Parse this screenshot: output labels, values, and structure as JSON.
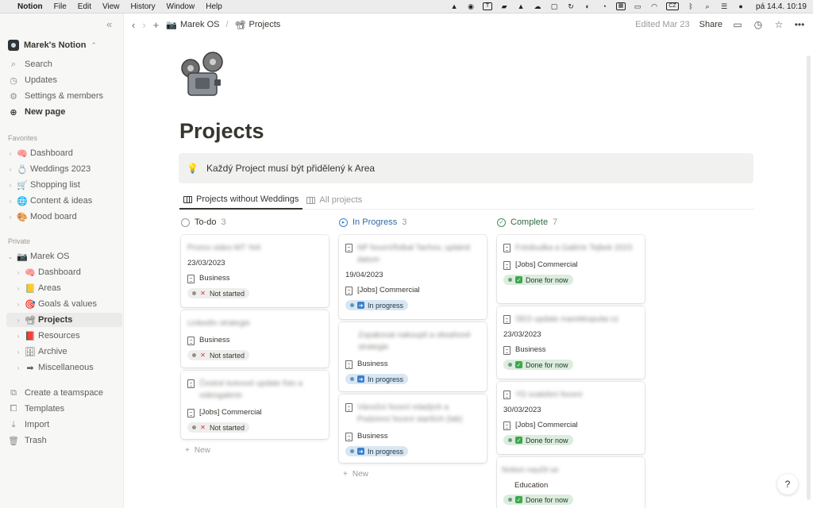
{
  "menubar": {
    "app": "Notion",
    "menus": [
      "File",
      "Edit",
      "View",
      "History",
      "Window",
      "Help"
    ],
    "keyboard": "CZ",
    "clock": "pá 14.4.  10:19"
  },
  "sidebar": {
    "workspace": "Marek's Notion",
    "top_items": [
      {
        "label": "Search",
        "icon": "search-icon"
      },
      {
        "label": "Updates",
        "icon": "clock-icon"
      },
      {
        "label": "Settings & members",
        "icon": "gear-icon"
      },
      {
        "label": "New page",
        "icon": "plus-circle-icon"
      }
    ],
    "favorites_label": "Favorites",
    "favorites": [
      {
        "label": "Dashboard",
        "emoji": "🧠"
      },
      {
        "label": "Weddings 2023",
        "emoji": "💍"
      },
      {
        "label": "Shopping list",
        "emoji": "🛒"
      },
      {
        "label": "Content & ideas",
        "emoji": "🌐"
      },
      {
        "label": "Mood board",
        "emoji": "🎨"
      }
    ],
    "private_label": "Private",
    "private_root": {
      "label": "Marek OS",
      "emoji": "📷"
    },
    "private_children": [
      {
        "label": "Dashboard",
        "emoji": "🧠"
      },
      {
        "label": "Areas",
        "emoji": "📒"
      },
      {
        "label": "Goals & values",
        "emoji": "🎯"
      },
      {
        "label": "Projects",
        "emoji": "📽"
      },
      {
        "label": "Resources",
        "emoji": "📕"
      },
      {
        "label": "Archive",
        "emoji": "🗄"
      },
      {
        "label": "Miscellaneous",
        "emoji": "➡"
      }
    ],
    "bottom_items": [
      {
        "label": "Create a teamspace",
        "icon": "teamspace-icon"
      },
      {
        "label": "Templates",
        "icon": "templates-icon"
      },
      {
        "label": "Import",
        "icon": "import-icon"
      },
      {
        "label": "Trash",
        "icon": "trash-icon"
      }
    ]
  },
  "topbar": {
    "breadcrumb_parent": "Marek OS",
    "breadcrumb_current": "Projects",
    "edited": "Edited Mar 23",
    "share": "Share"
  },
  "page": {
    "title": "Projects",
    "callout": "Každý Project musí být přidělený k Area",
    "tabs": [
      "Projects without Weddings",
      "All projects"
    ]
  },
  "board": {
    "new_label": "New",
    "columns": [
      {
        "name": "To-do",
        "count": "3",
        "cards": [
          {
            "title": "Promo video MT Yeti",
            "date": "23/03/2023",
            "relation": "Business",
            "status": "Not started"
          },
          {
            "title": "LinkedIn strategie",
            "date": "",
            "relation": "Business",
            "status": "Not started"
          },
          {
            "title": "Čestné kotvové update foto a videogalerie",
            "date": "",
            "relation": "[Jobs] Commercial",
            "status": "Not started"
          }
        ]
      },
      {
        "name": "In Progress",
        "count": "3",
        "cards": [
          {
            "title": "NP focení/fotbal Tachov, uplatnit datum",
            "date": "19/04/2023",
            "relation": "[Jobs] Commercial",
            "status": "In progress"
          },
          {
            "title": "Zopakovat nakoupit a obsahové strategie",
            "date": "",
            "relation": "Business",
            "status": "In progress"
          },
          {
            "title": "Vánoční focení mladých a Podzimní focení starších (lab)",
            "date": "",
            "relation": "Business",
            "status": "In progress"
          }
        ]
      },
      {
        "name": "Complete",
        "count": "7",
        "cards": [
          {
            "title": "Fotobudka a Galérie Tejbek 2023",
            "date": "",
            "relation": "[Jobs] Commercial",
            "status": "Done for now"
          },
          {
            "title": "SEO update marekkopular.cz",
            "date": "23/03/2023",
            "relation": "Business",
            "status": "Done for now"
          },
          {
            "title": "YD svatební focení",
            "date": "30/03/2023",
            "relation": "[Jobs] Commercial",
            "status": "Done for now"
          },
          {
            "title": "Notion naučit se",
            "date": "",
            "relation": "Education",
            "status": "Done for now"
          }
        ]
      }
    ]
  },
  "help": "?"
}
